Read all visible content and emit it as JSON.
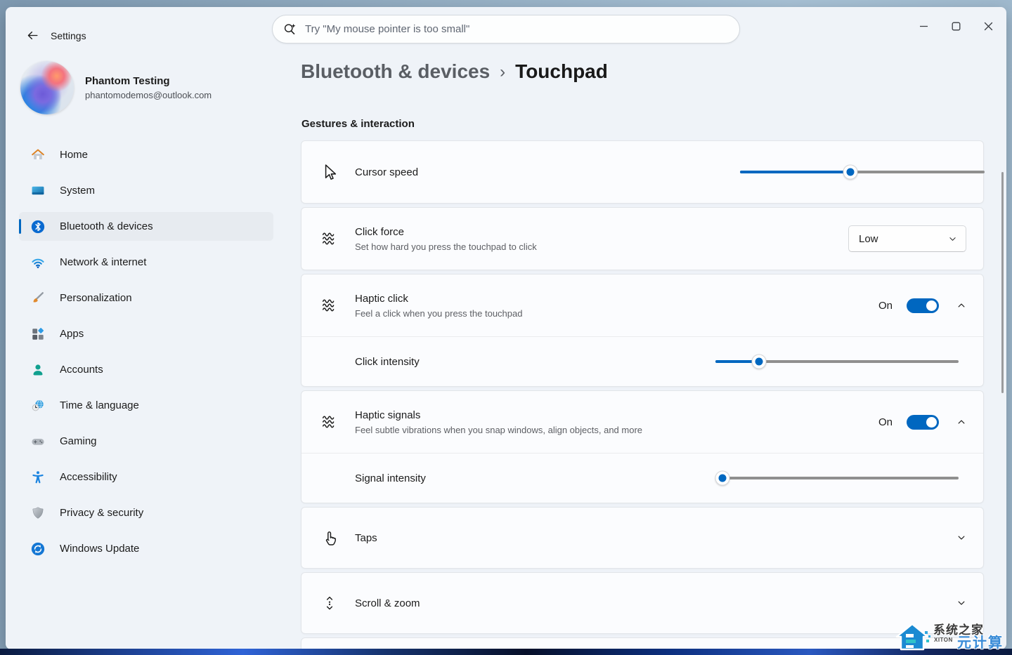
{
  "titlebar": {
    "app_title": "Settings"
  },
  "search": {
    "placeholder": "Try \"My mouse pointer is too small\""
  },
  "user": {
    "name": "Phantom Testing",
    "email": "phantomodemos@outlook.com"
  },
  "sidebar": {
    "items": [
      {
        "label": "Home",
        "icon": "home-icon",
        "selected": false
      },
      {
        "label": "System",
        "icon": "system-icon",
        "selected": false
      },
      {
        "label": "Bluetooth & devices",
        "icon": "bluetooth-icon",
        "selected": true
      },
      {
        "label": "Network & internet",
        "icon": "network-icon",
        "selected": false
      },
      {
        "label": "Personalization",
        "icon": "personalization-icon",
        "selected": false
      },
      {
        "label": "Apps",
        "icon": "apps-icon",
        "selected": false
      },
      {
        "label": "Accounts",
        "icon": "accounts-icon",
        "selected": false
      },
      {
        "label": "Time & language",
        "icon": "time-language-icon",
        "selected": false
      },
      {
        "label": "Gaming",
        "icon": "gaming-icon",
        "selected": false
      },
      {
        "label": "Accessibility",
        "icon": "accessibility-icon",
        "selected": false
      },
      {
        "label": "Privacy & security",
        "icon": "privacy-security-icon",
        "selected": false
      },
      {
        "label": "Windows Update",
        "icon": "windows-update-icon",
        "selected": false
      }
    ]
  },
  "breadcrumb": {
    "parent": "Bluetooth & devices",
    "separator": "›",
    "current": "Touchpad"
  },
  "section": {
    "title": "Gestures & interaction"
  },
  "cards": {
    "cursor_speed": {
      "title": "Cursor speed",
      "slider_percent": 45
    },
    "click_force": {
      "title": "Click force",
      "subtitle": "Set how hard you press the touchpad to click",
      "dropdown_value": "Low"
    },
    "haptic_click": {
      "title": "Haptic click",
      "subtitle": "Feel a click when you press the touchpad",
      "toggle_state": "On",
      "intensity_label": "Click intensity",
      "slider_percent": 18
    },
    "haptic_signals": {
      "title": "Haptic signals",
      "subtitle": "Feel subtle vibrations when you snap windows, align objects, and more",
      "toggle_state": "On",
      "intensity_label": "Signal intensity",
      "slider_percent": 3
    },
    "taps": {
      "title": "Taps"
    },
    "scroll_zoom": {
      "title": "Scroll & zoom"
    }
  },
  "watermark": {
    "title": "系统之家",
    "subtitle": "XITON",
    "overlay": "元计算"
  },
  "colors": {
    "accent": "#0067c0",
    "window_bg": "#eff3f8",
    "card_bg": "#fbfcfe"
  }
}
